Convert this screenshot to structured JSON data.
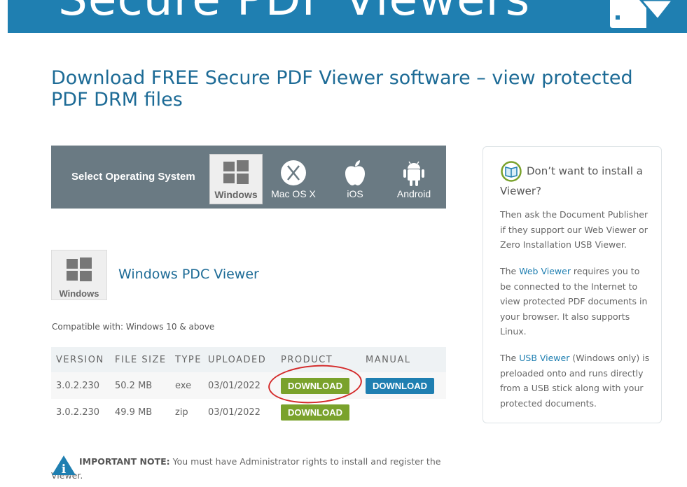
{
  "banner": {
    "title": "Secure PDF Viewers",
    "icon": "document-download-icon",
    "color": "#1f7fb1"
  },
  "page_title": "Download FREE Secure PDF Viewer software – view protected PDF DRM files",
  "os_selector": {
    "label": "Select Operating System",
    "options": [
      {
        "label": "Windows",
        "icon": "windows-icon",
        "selected": true
      },
      {
        "label": "Mac OS X",
        "icon": "mac-os-x-icon",
        "selected": false
      },
      {
        "label": "iOS",
        "icon": "apple-icon",
        "selected": false
      },
      {
        "label": "Android",
        "icon": "android-icon",
        "selected": false
      }
    ]
  },
  "product": {
    "icon_label": "Windows",
    "title": "Windows PDC Viewer"
  },
  "compatible": "Compatible with:  Windows 10 & above",
  "table": {
    "headers": [
      "VERSION",
      "FILE SIZE",
      "TYPE",
      "UPLOADED",
      "PRODUCT",
      "MANUAL"
    ],
    "rows": [
      {
        "version": "3.0.2.230",
        "size": "50.2 MB",
        "type": "exe",
        "uploaded": "03/01/2022",
        "product_btn": "DOWNLOAD",
        "manual_btn": "DOWNLOAD"
      },
      {
        "version": "3.0.2.230",
        "size": "49.9 MB",
        "type": "zip",
        "uploaded": "03/01/2022",
        "product_btn": "DOWNLOAD",
        "manual_btn": ""
      }
    ]
  },
  "sidebar": {
    "heading": "Don’t want to install a Viewer?",
    "p1": "Then ask the Document Publisher if they support our Web Viewer or Zero Installation USB Viewer.",
    "p2_pre": "The ",
    "p2_link": "Web Viewer",
    "p2_post": " requires you to be connected to the Internet to view protected PDF documents in your browser.  It also supports Linux.",
    "p3_pre": "The ",
    "p3_link": "USB Viewer",
    "p3_post": " (Windows only) is preloaded onto and runs directly from a USB stick along with your protected documents."
  },
  "note": {
    "label": "IMPORTANT NOTE:",
    "text": " You must have Administrator rights to install and register the Viewer."
  },
  "colors": {
    "accent": "#1f7fb1",
    "title": "#1d6b96",
    "download_green": "#7aa22c",
    "os_bar": "#6a7a83",
    "annotation_red": "#d42a2a"
  }
}
